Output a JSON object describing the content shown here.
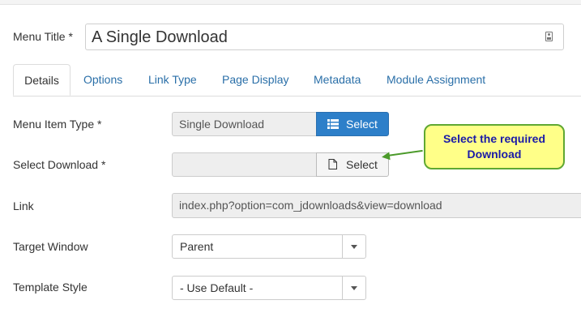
{
  "menu_title": {
    "label": "Menu Title *",
    "value": "A Single Download"
  },
  "tabs": [
    {
      "label": "Details",
      "active": true
    },
    {
      "label": "Options"
    },
    {
      "label": "Link Type"
    },
    {
      "label": "Page Display"
    },
    {
      "label": "Metadata"
    },
    {
      "label": "Module Assignment"
    }
  ],
  "menu_item_type": {
    "label": "Menu Item Type *",
    "value": "Single Download",
    "button": "Select"
  },
  "select_download": {
    "label": "Select Download *",
    "value": "",
    "button": "Select"
  },
  "link": {
    "label": "Link",
    "value": "index.php?option=com_jdownloads&view=download"
  },
  "target_window": {
    "label": "Target Window",
    "value": "Parent"
  },
  "template_style": {
    "label": "Template Style",
    "value": "- Use Default -"
  },
  "callout": {
    "line1": "Select the required",
    "line2": "Download"
  },
  "colors": {
    "primary_button": "#2d7fc9",
    "tab_link": "#2a6fa8",
    "callout_bg": "#ffff88",
    "callout_border": "#5fa832",
    "callout_text": "#1a1aa8"
  }
}
